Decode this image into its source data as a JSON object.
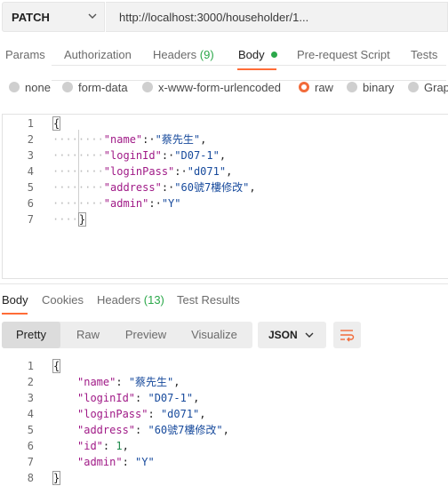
{
  "request": {
    "method": "PATCH",
    "url": "http://localhost:3000/householder/1..."
  },
  "request_tabs": [
    {
      "label": "Params"
    },
    {
      "label": "Authorization"
    },
    {
      "label": "Headers",
      "count": "(9)"
    },
    {
      "label": "Body"
    },
    {
      "label": "Pre-request Script"
    },
    {
      "label": "Tests"
    }
  ],
  "body_types": [
    "none",
    "form-data",
    "x-www-form-urlencoded",
    "raw",
    "binary",
    "Grap"
  ],
  "selected_body_type": "raw",
  "request_body": {
    "line_numbers": [
      "1",
      "2",
      "3",
      "4",
      "5",
      "6",
      "7"
    ],
    "open_brace": "{",
    "close_brace": "}",
    "fields": [
      {
        "key": "\"name\"",
        "value": "\"蔡先生\""
      },
      {
        "key": "\"loginId\"",
        "value": "\"D07-1\""
      },
      {
        "key": "\"loginPass\"",
        "value": "\"d071\""
      },
      {
        "key": "\"address\"",
        "value": "\"60號7樓修改\""
      },
      {
        "key": "\"admin\"",
        "value": "\"Y\""
      }
    ]
  },
  "response_tabs": [
    {
      "label": "Body"
    },
    {
      "label": "Cookies"
    },
    {
      "label": "Headers",
      "count": "(13)"
    },
    {
      "label": "Test Results"
    }
  ],
  "view_modes": [
    "Pretty",
    "Raw",
    "Preview",
    "Visualize"
  ],
  "active_view": "Pretty",
  "format": "JSON",
  "response_body": {
    "line_numbers": [
      "1",
      "2",
      "3",
      "4",
      "5",
      "6",
      "7",
      "8"
    ],
    "open_brace": "{",
    "close_brace": "}",
    "fields": [
      {
        "key": "\"name\"",
        "value": "\"蔡先生\"",
        "kind": "str"
      },
      {
        "key": "\"loginId\"",
        "value": "\"D07-1\"",
        "kind": "str"
      },
      {
        "key": "\"loginPass\"",
        "value": "\"d071\"",
        "kind": "str"
      },
      {
        "key": "\"address\"",
        "value": "\"60號7樓修改\"",
        "kind": "str"
      },
      {
        "key": "\"id\"",
        "value": "1",
        "kind": "num"
      },
      {
        "key": "\"admin\"",
        "value": "\"Y\"",
        "kind": "str"
      }
    ]
  },
  "colors": {
    "accent": "#ff6c37",
    "count_green": "#2ba84a",
    "json_key": "#a01a87",
    "json_string": "#174a9c",
    "json_number": "#1f8a4c"
  },
  "icons": {
    "method_dropdown": "chevron-down-icon",
    "format_dropdown": "chevron-down-icon",
    "wrap": "word-wrap-icon"
  }
}
